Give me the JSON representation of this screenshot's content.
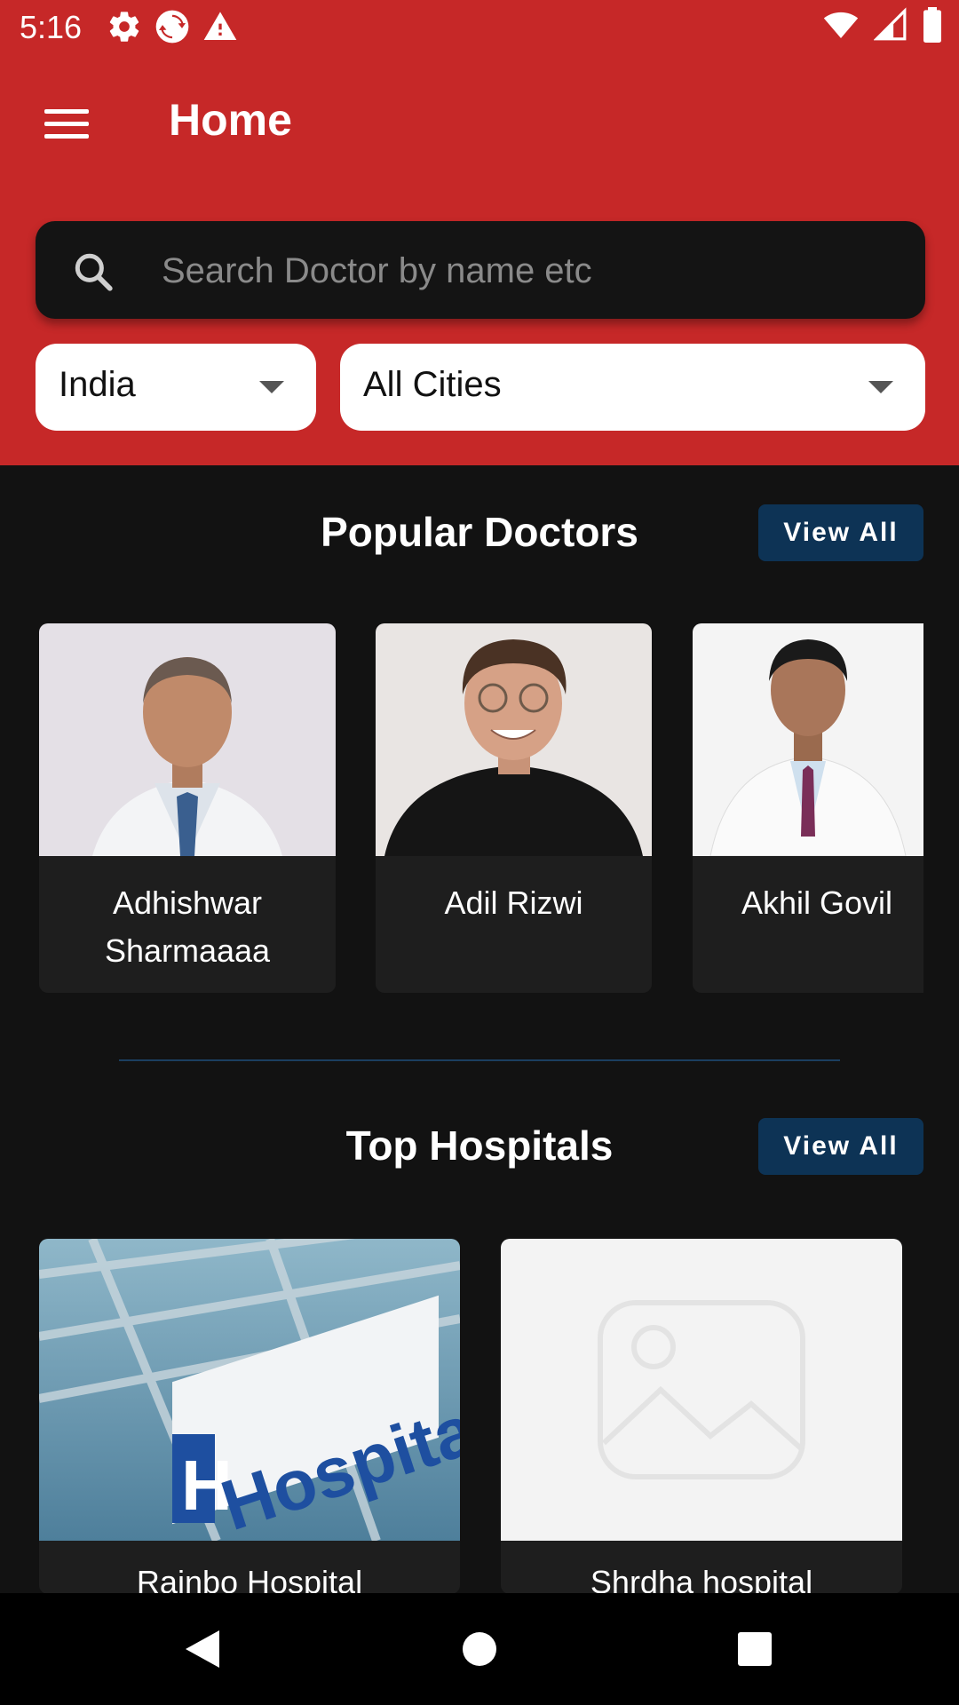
{
  "status_bar": {
    "time": "5:16",
    "left_icons": [
      "gear-icon",
      "sync-icon",
      "warning-icon"
    ],
    "right_icons": [
      "wifi-icon",
      "signal-icon",
      "battery-icon"
    ]
  },
  "app_bar": {
    "title": "Home",
    "menu_icon": "hamburger-icon"
  },
  "search": {
    "placeholder": "Search Doctor by name etc",
    "value": ""
  },
  "filters": {
    "country": "India",
    "city": "All Cities"
  },
  "popular_doctors": {
    "title": "Popular Doctors",
    "view_all_label": "View All",
    "doctors": [
      {
        "name": "Adhishwar Sharmaaaa"
      },
      {
        "name": "Adil Rizwi"
      },
      {
        "name": "Akhil Govil"
      }
    ]
  },
  "top_hospitals": {
    "title": "Top Hospitals",
    "view_all_label": "View All",
    "hospitals": [
      {
        "name": "Rainbo Hospital",
        "sign_text": "Hospital",
        "sign_letter": "H"
      },
      {
        "name": "Shrdha hospital"
      }
    ]
  },
  "nav_bar": {
    "buttons": [
      "back-icon",
      "home-icon",
      "recents-icon"
    ]
  },
  "colors": {
    "primary": "#C62828",
    "background": "#121212",
    "card": "#1E1E1E",
    "button": "#0D3355"
  }
}
